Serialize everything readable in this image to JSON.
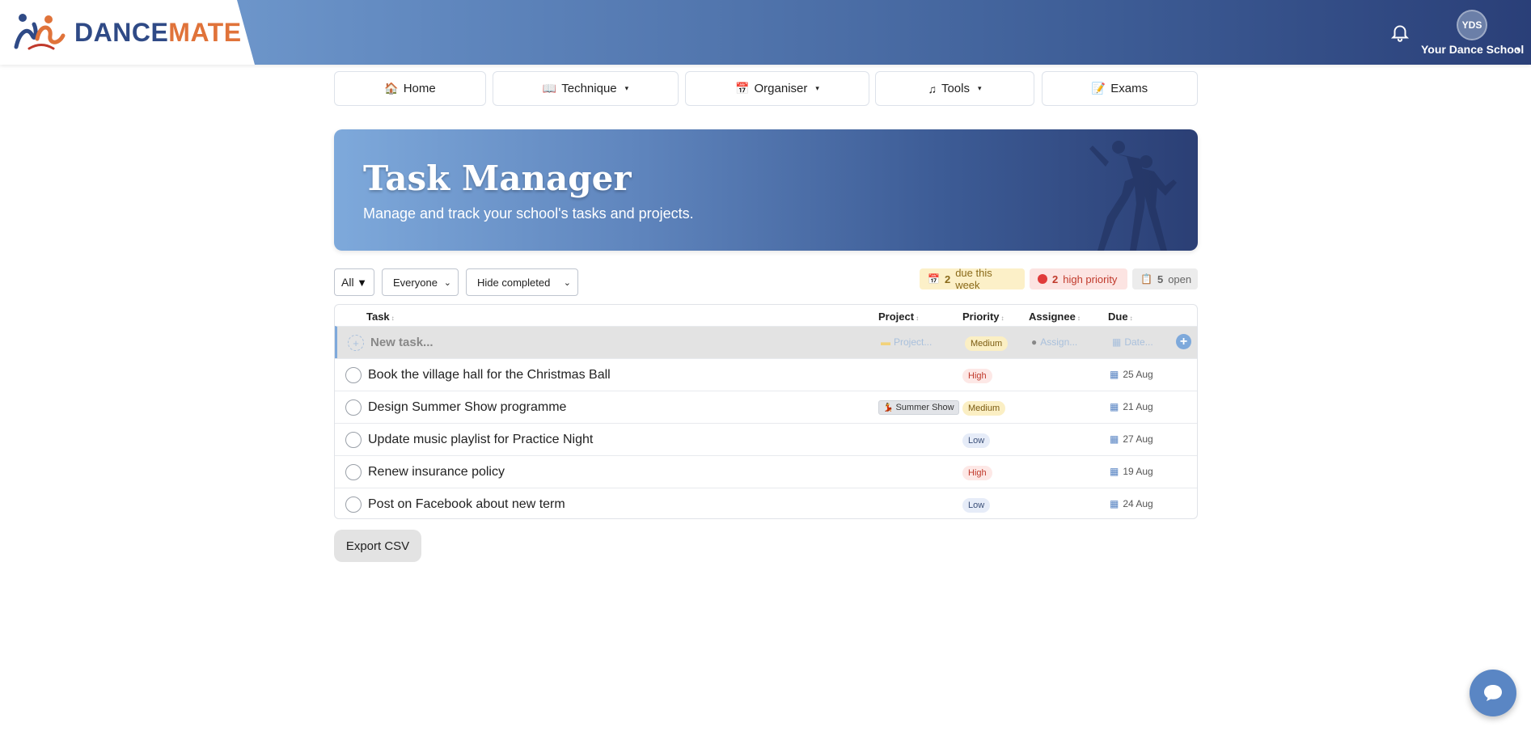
{
  "brand": {
    "name_part1": "DANCE",
    "name_part2": "MATE",
    "accent_blue": "#2f4a86",
    "accent_orange": "#e0733a"
  },
  "header": {
    "avatar_initials": "YDS",
    "school_name": "Your Dance School",
    "bell_icon": "bell-icon"
  },
  "nav": [
    {
      "label": "Home",
      "icon": "house-icon"
    },
    {
      "label": "Technique",
      "icon": "book-icon",
      "dropdown": true
    },
    {
      "label": "Organiser",
      "icon": "calendar-icon",
      "dropdown": true
    },
    {
      "label": "Tools",
      "icon": "music-note-icon",
      "dropdown": true
    },
    {
      "label": "Exams",
      "icon": "memo-icon"
    }
  ],
  "banner": {
    "title": "Task Manager",
    "subtitle": "Manage and track your school's tasks and projects."
  },
  "filters": {
    "scope": "All",
    "assignee": "Everyone",
    "completed": "Hide completed"
  },
  "stats": {
    "due_count": "2",
    "due_label": "due this week",
    "high_count": "2",
    "high_label": "high priority",
    "open_count": "5",
    "open_label": "open"
  },
  "table": {
    "headers": {
      "task": "Task",
      "project": "Project",
      "priority": "Priority",
      "assignee": "Assignee",
      "due": "Due"
    },
    "new_row": {
      "task_placeholder": "New task...",
      "project_placeholder": "Project...",
      "priority": "Medium",
      "assignee_placeholder": "Assign...",
      "due_placeholder": "Date..."
    },
    "rows": [
      {
        "task": "Book the village hall for the Christmas Ball",
        "project": "",
        "priority": "High",
        "due": "25 Aug"
      },
      {
        "task": "Design Summer Show programme",
        "project": "Summer Show",
        "priority": "Medium",
        "due": "21 Aug"
      },
      {
        "task": "Update music playlist for Practice Night",
        "project": "",
        "priority": "Low",
        "due": "27 Aug"
      },
      {
        "task": "Renew insurance policy",
        "project": "",
        "priority": "High",
        "due": "19 Aug"
      },
      {
        "task": "Post on Facebook about new term",
        "project": "",
        "priority": "Low",
        "due": "24 Aug"
      }
    ]
  },
  "export_label": "Export CSV",
  "chat_icon": "chat-bubble-icon"
}
